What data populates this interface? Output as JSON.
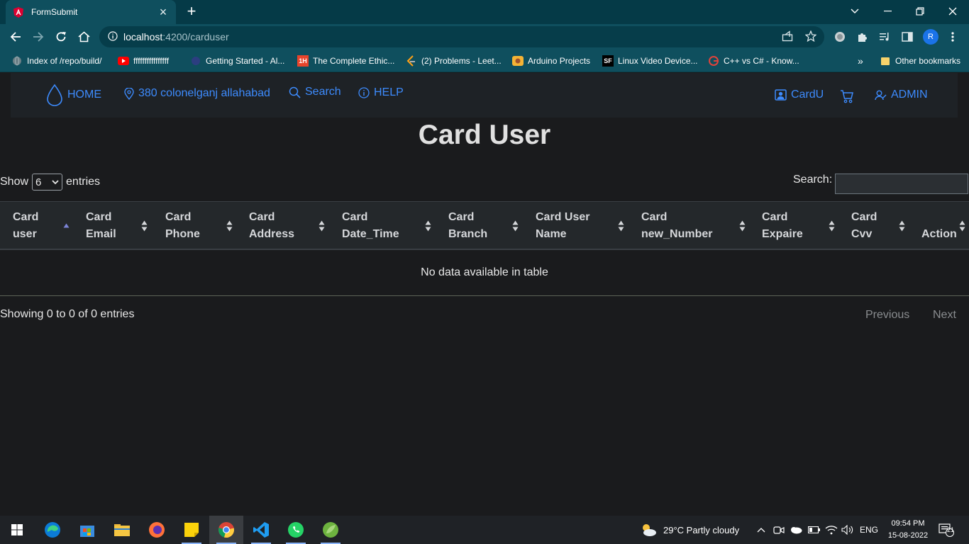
{
  "browser": {
    "tab_title": "FormSubmit",
    "tab_close": "×",
    "new_tab": "+",
    "url_host": "localhost",
    "url_path": ":4200/carduser",
    "profile_initial": "R"
  },
  "bookmarks": [
    {
      "label": "Index of /repo/build/",
      "icon": "globe-icon"
    },
    {
      "label": "ffffffffffffffff",
      "icon": "youtube-icon"
    },
    {
      "label": "Getting Started - Al...",
      "icon": "page-icon"
    },
    {
      "label": "The Complete Ethic...",
      "icon": "1h-icon"
    },
    {
      "label": "(2) Problems - Leet...",
      "icon": "leetcode-icon"
    },
    {
      "label": "Arduino Projects",
      "icon": "arduino-icon"
    },
    {
      "label": "Linux Video Device...",
      "icon": "sf-icon"
    },
    {
      "label": "C++ vs C# - Know...",
      "icon": "edureka-icon"
    }
  ],
  "bookmarks_overflow": "»",
  "other_bookmarks": "Other bookmarks",
  "navbar": {
    "home": "HOME",
    "location": "380 colonelganj allahabad",
    "search": "Search",
    "help": "HELP",
    "cardu": "CardU",
    "admin": "ADMIN"
  },
  "page_title": "Card User",
  "table_controls": {
    "show": "Show",
    "entries_value": "6",
    "entries": "entries",
    "search_label": "Search:"
  },
  "columns": [
    "Card\nuser",
    "Card\nEmail",
    "Card\nPhone",
    "Card\nAddress",
    "Card\nDate_Time",
    "Card\nBranch",
    "Card User\nName",
    "Card\nnew_Number",
    "Card\nExpaire",
    "Card\nCvv",
    "Action"
  ],
  "empty_message": "No data available in table",
  "info": "Showing 0 to 0 of 0 entries",
  "pagination": {
    "previous": "Previous",
    "next": "Next"
  },
  "taskbar": {
    "weather": "29°C  Partly cloudy",
    "lang": "ENG",
    "time": "09:54 PM",
    "date": "15-08-2022",
    "notifications": "21"
  },
  "colors": {
    "chrome_frame": "#053a47",
    "chrome_toolbar": "#0f4f5e",
    "page_bg": "#1a1b1d",
    "link_blue": "#3d8bfd"
  }
}
